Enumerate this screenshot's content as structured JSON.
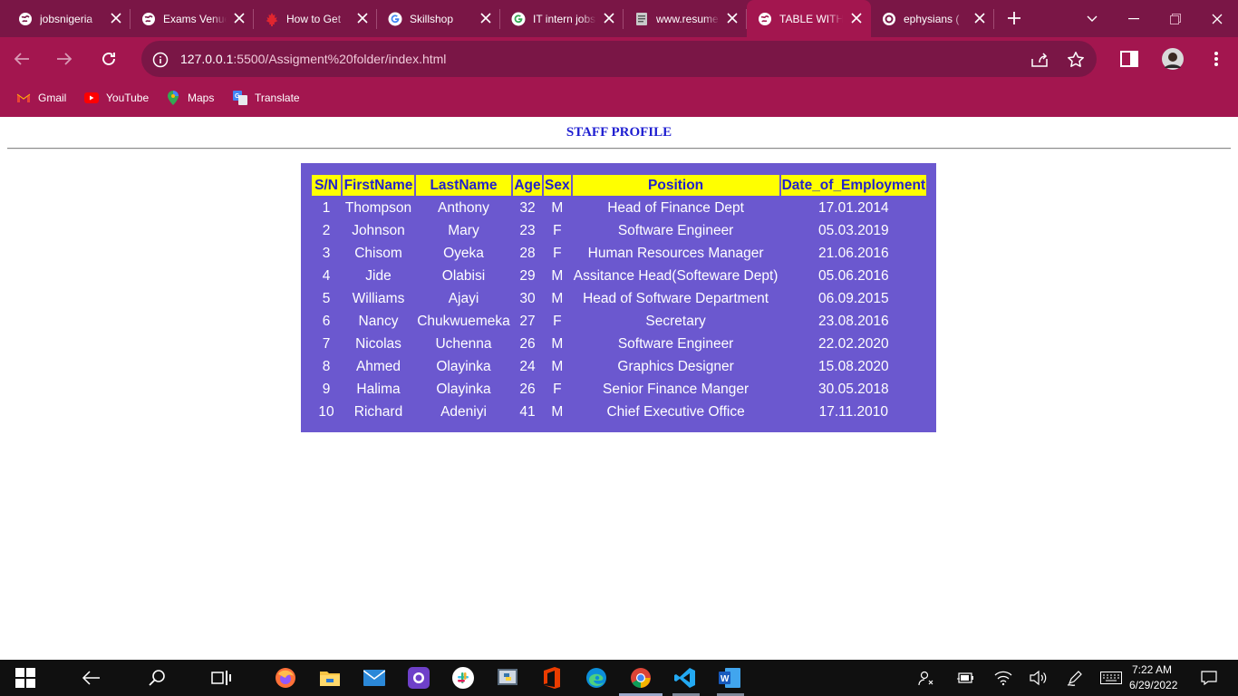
{
  "browser": {
    "tabs": [
      {
        "title": "jobsnigeria",
        "icon": "globe-icon"
      },
      {
        "title": "Exams Venue",
        "icon": "globe-icon"
      },
      {
        "title": "How to Get",
        "icon": "maple-leaf-icon"
      },
      {
        "title": "Skillshop",
        "icon": "google-icon"
      },
      {
        "title": "IT intern jobs",
        "icon": "google-icon"
      },
      {
        "title": "www.resume",
        "icon": "document-icon"
      },
      {
        "title": "TABLE WITH",
        "icon": "globe-icon",
        "active": true
      },
      {
        "title": "ephysians (",
        "icon": "github-icon"
      }
    ],
    "url_host": "127.0.0.1",
    "url_rest": ":5500/Assigment%20folder/index.html",
    "bookmarks": [
      {
        "label": "Gmail",
        "icon": "gmail-icon"
      },
      {
        "label": "YouTube",
        "icon": "youtube-icon"
      },
      {
        "label": "Maps",
        "icon": "maps-icon"
      },
      {
        "label": "Translate",
        "icon": "translate-icon"
      }
    ]
  },
  "page": {
    "heading": "STAFF PROFILE",
    "table": {
      "headers": [
        "S/N",
        "FirstName",
        "LastName",
        "Age",
        "Sex",
        "Position",
        "Date_of_Employment"
      ],
      "rows": [
        [
          "1",
          "Thompson",
          "Anthony",
          "32",
          "M",
          "Head of Finance Dept",
          "17.01.2014"
        ],
        [
          "2",
          "Johnson",
          "Mary",
          "23",
          "F",
          "Software Engineer",
          "05.03.2019"
        ],
        [
          "3",
          "Chisom",
          "Oyeka",
          "28",
          "F",
          "Human Resources Manager",
          "21.06.2016"
        ],
        [
          "4",
          "Jide",
          "Olabisi",
          "29",
          "M",
          "Assitance Head(Softeware Dept)",
          "05.06.2016"
        ],
        [
          "5",
          "Williams",
          "Ajayi",
          "30",
          "M",
          "Head of Software Department",
          "06.09.2015"
        ],
        [
          "6",
          "Nancy",
          "Chukwuemeka",
          "27",
          "F",
          "Secretary",
          "23.08.2016"
        ],
        [
          "7",
          "Nicolas",
          "Uchenna",
          "26",
          "M",
          "Software Engineer",
          "22.02.2020"
        ],
        [
          "8",
          "Ahmed",
          "Olayinka",
          "24",
          "M",
          "Graphics Designer",
          "15.08.2020"
        ],
        [
          "9",
          "Halima",
          "Olayinka",
          "26",
          "F",
          "Senior Finance Manger",
          "30.05.2018"
        ],
        [
          "10",
          "Richard",
          "Adeniyi",
          "41",
          "M",
          "Chief Executive Office",
          "17.11.2010"
        ]
      ]
    }
  },
  "taskbar": {
    "time": "7:22 AM",
    "date": "6/29/2022"
  },
  "colors": {
    "tabstrip": "#7a1646",
    "toolbar": "#a3164f",
    "table_bg": "#6b58cf",
    "header_bg": "#ffff00",
    "header_text": "#2222cc",
    "heading_text": "#1f1fd1"
  }
}
